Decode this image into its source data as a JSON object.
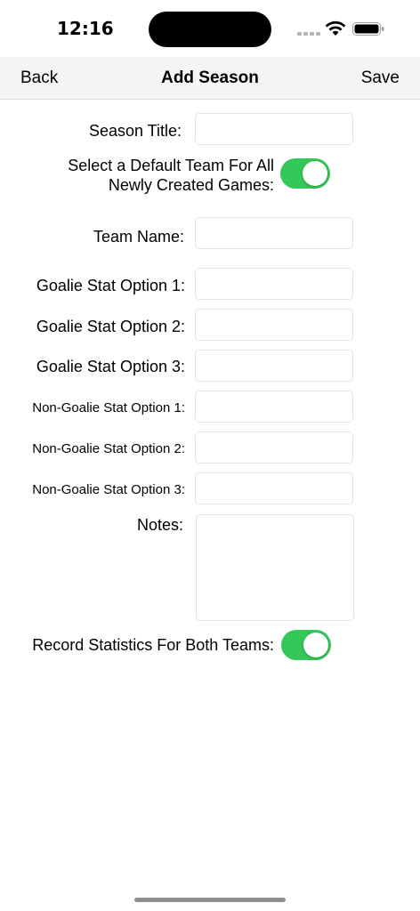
{
  "status_bar": {
    "time": "12:16",
    "icons": [
      "signal-icon",
      "wifi-icon",
      "battery-icon"
    ]
  },
  "nav": {
    "back_label": "Back",
    "title": "Add Season",
    "save_label": "Save"
  },
  "form": {
    "season_title_label": "Season Title:",
    "season_title_value": "",
    "default_team_label_line1": "Select a Default Team For All",
    "default_team_label_line2": "Newly Created Games:",
    "default_team_toggle": true,
    "team_name_label": "Team Name:",
    "team_name_value": "",
    "goalie_stat_1_label": "Goalie Stat Option 1:",
    "goalie_stat_1_value": "",
    "goalie_stat_2_label": "Goalie Stat Option 2:",
    "goalie_stat_2_value": "",
    "goalie_stat_3_label": "Goalie Stat Option 3:",
    "goalie_stat_3_value": "",
    "non_goalie_stat_1_label": "Non-Goalie Stat Option 1:",
    "non_goalie_stat_1_value": "",
    "non_goalie_stat_2_label": "Non-Goalie Stat Option 2:",
    "non_goalie_stat_2_value": "",
    "non_goalie_stat_3_label": "Non-Goalie Stat Option 3:",
    "non_goalie_stat_3_value": "",
    "notes_label": "Notes:",
    "notes_value": "",
    "both_teams_label": "Record Statistics For Both Teams:",
    "both_teams_toggle": true
  },
  "colors": {
    "toggle_on": "#34c759",
    "nav_background": "#f4f4f4"
  }
}
